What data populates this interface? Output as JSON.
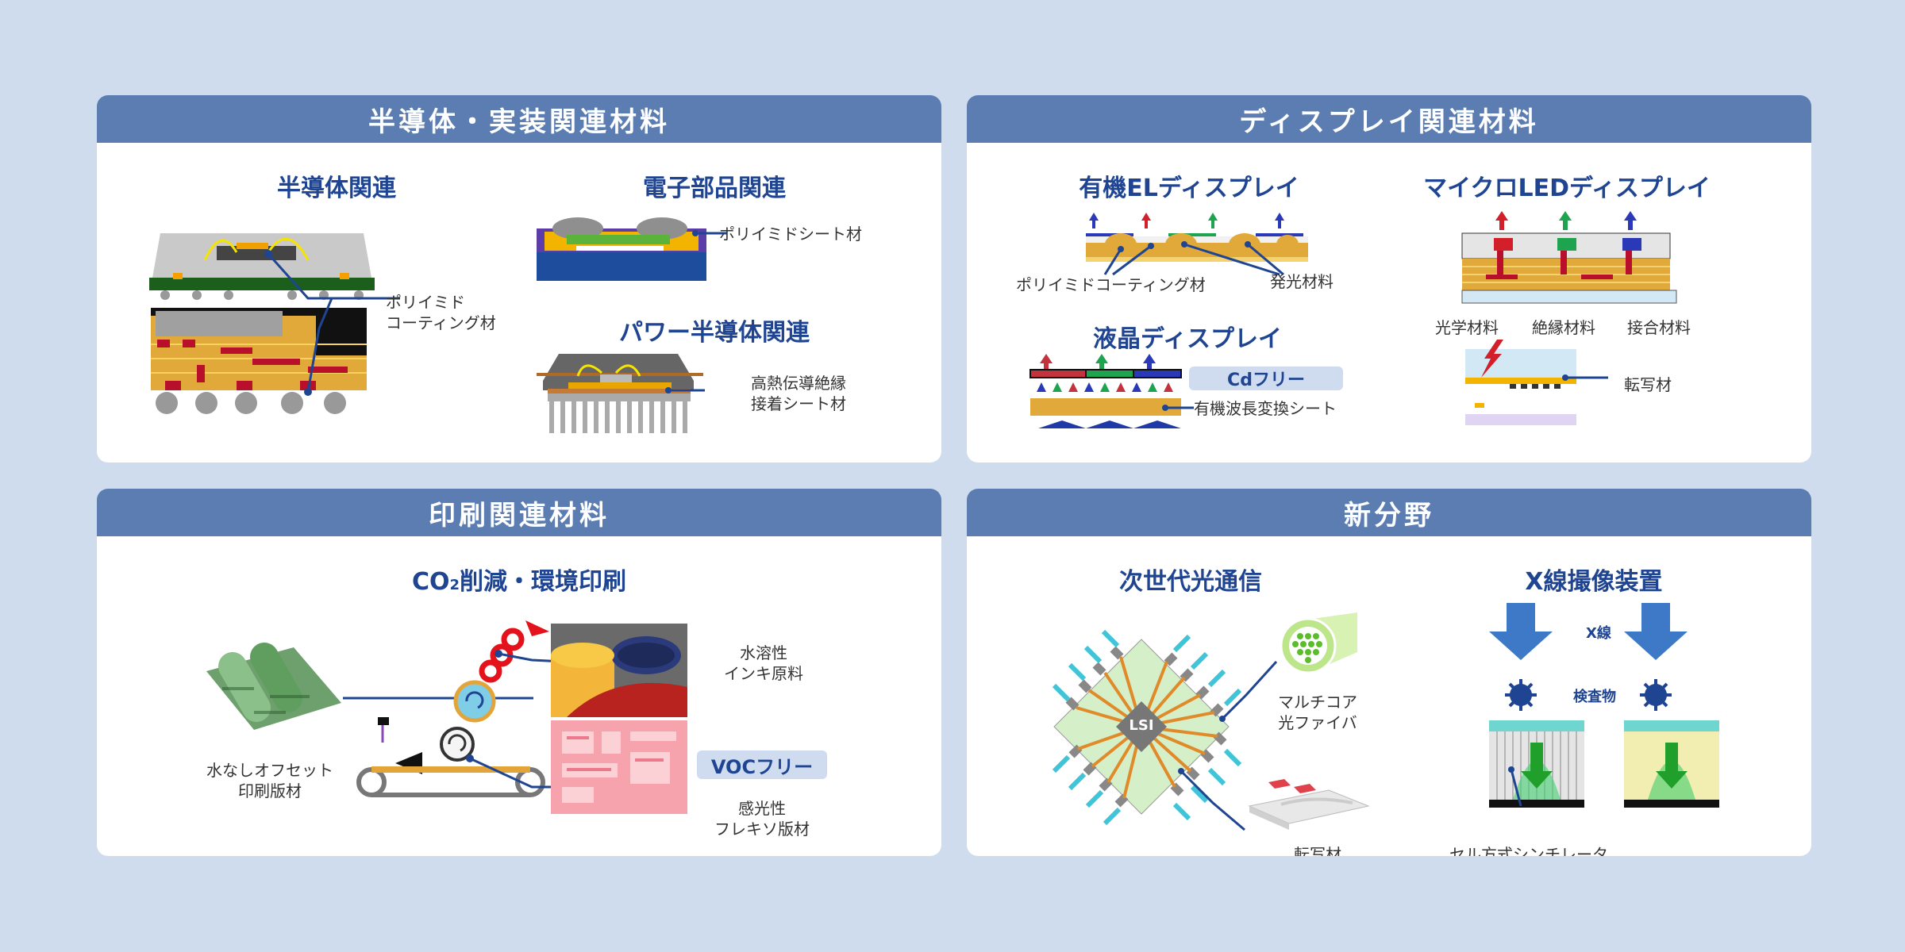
{
  "panels": {
    "semiconductor": {
      "title": "半導体・実装関連材料",
      "semi_title": "半導体関連",
      "semi_label_1": "ポリイミド",
      "semi_label_2": "コーティング材",
      "elec_title": "電子部品関連",
      "elec_label": "ポリイミドシート材",
      "power_title": "パワー半導体関連",
      "power_label_1": "高熱伝導絶縁",
      "power_label_2": "接着シート材"
    },
    "display": {
      "title": "ディスプレイ関連材料",
      "oled_title": "有機ELディスプレイ",
      "oled_label_left": "ポリイミドコーティング材",
      "oled_label_right": "発光材料",
      "micro_title": "マイクロLEDディスプレイ",
      "micro_label_1": "光学材料",
      "micro_label_2": "絶縁材料",
      "micro_label_3": "接合材料",
      "lcd_title": "液晶ディスプレイ",
      "cd_free": "Cdフリー",
      "lcd_label": "有機波長変換シート",
      "transfer_label": "転写材"
    },
    "printing": {
      "title": "印刷関連材料",
      "sub_title_prefix": "CO",
      "sub_title_sub": "2",
      "sub_title_suffix": "削減・環境印刷",
      "waterless_1": "水なしオフセット",
      "waterless_2": "印刷版材",
      "ink_1": "水溶性",
      "ink_2": "インキ原料",
      "voc_free": "VOCフリー",
      "flexo_1": "感光性",
      "flexo_2": "フレキソ版材"
    },
    "newfield": {
      "title": "新分野",
      "optical_title": "次世代光通信",
      "xray_title": "X線撮像装置",
      "lsi": "LSI",
      "fiber_1": "マルチコア",
      "fiber_2": "光ファイバ",
      "transfer": "転写材",
      "xray_label": "X線",
      "inspected": "検査物",
      "scintillator": "セル方式シンチレータ"
    }
  },
  "colors": {
    "header": "#5b7db2",
    "accent": "#1f4592",
    "background": "#cfdcee",
    "pill": "#cfdcf0"
  }
}
